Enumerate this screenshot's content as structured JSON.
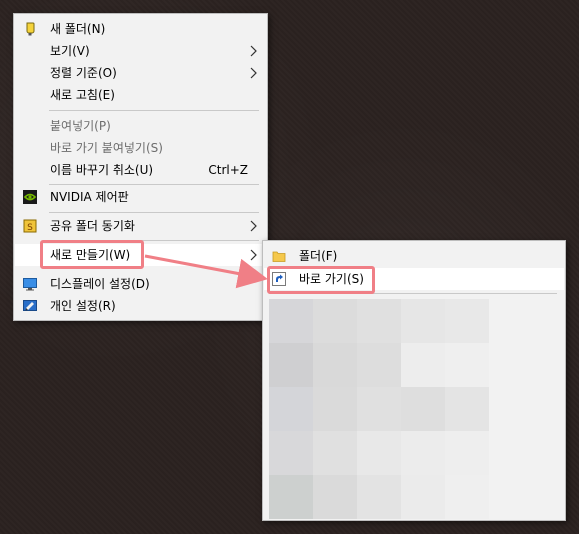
{
  "context_menu": {
    "items": [
      {
        "label": "새 폴더(N)",
        "icon": "new-folder-icon"
      },
      {
        "label": "보기(V)",
        "submenu": true
      },
      {
        "label": "정렬 기준(O)",
        "submenu": true
      },
      {
        "label": "새로 고침(E)"
      },
      {
        "label": "붙여넣기(P)",
        "disabled": true
      },
      {
        "label": "바로 가기 붙여넣기(S)",
        "disabled": true
      },
      {
        "label": "이름 바꾸기 취소(U)",
        "shortcut": "Ctrl+Z"
      },
      {
        "label": "NVIDIA 제어판",
        "icon": "nvidia-icon"
      },
      {
        "label": "공유 폴더 동기화",
        "icon": "sync-icon",
        "submenu": true
      },
      {
        "label": "새로 만들기(W)",
        "submenu": true,
        "highlighted": true
      },
      {
        "label": "디스플레이 설정(D)",
        "icon": "display-icon"
      },
      {
        "label": "개인 설정(R)",
        "icon": "personalize-icon"
      }
    ]
  },
  "new_submenu": {
    "items": [
      {
        "label": "폴더(F)",
        "icon": "folder-icon"
      },
      {
        "label": "바로 가기(S)",
        "icon": "shortcut-icon",
        "highlighted": true
      }
    ],
    "blurred_area": "pixelated-items"
  },
  "colors": {
    "background": "#2b2220",
    "menu_bg": "#f2f2f2",
    "highlight": "#f07f86",
    "disabled_text": "#6d6d6d",
    "nvidia_green": "#76b900"
  }
}
